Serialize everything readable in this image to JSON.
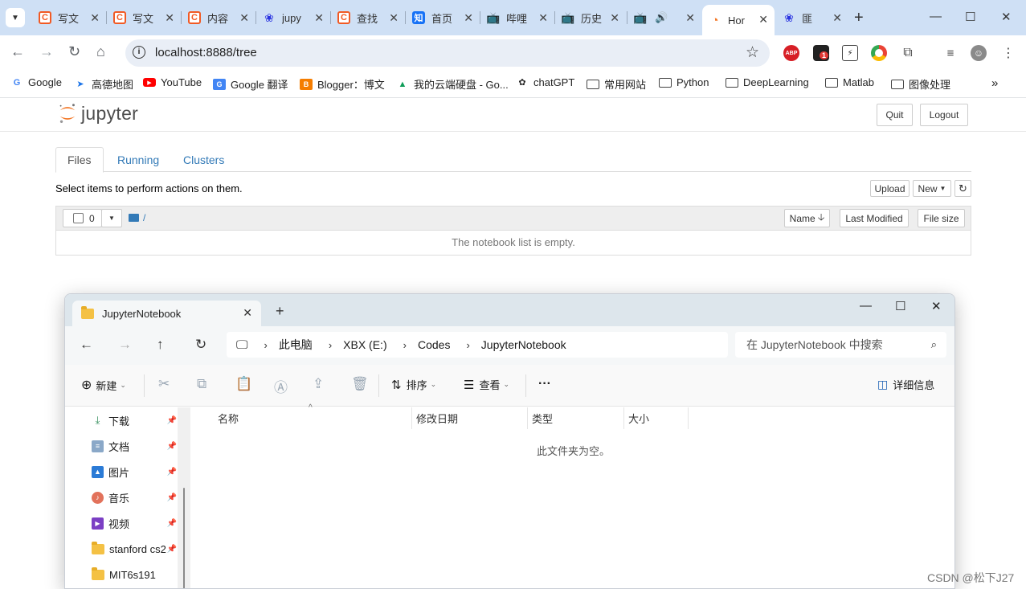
{
  "browser": {
    "tabs": [
      {
        "title": "写文",
        "favicon": "csdn-icon"
      },
      {
        "title": "写文",
        "favicon": "csdn-icon"
      },
      {
        "title": "内容",
        "favicon": "csdn-icon"
      },
      {
        "title": "jupy",
        "favicon": "baidu-icon"
      },
      {
        "title": "查找",
        "favicon": "csdn-icon"
      },
      {
        "title": "首页",
        "favicon": "zhihu-icon"
      },
      {
        "title": "哔哩",
        "favicon": "bilibili-icon"
      },
      {
        "title": "历史",
        "favicon": "bilibili-icon"
      },
      {
        "title": "",
        "favicon": "bilibili-icon"
      },
      {
        "title": "Hor",
        "favicon": "jupyter-icon"
      },
      {
        "title": "匪",
        "favicon": "baidu-icon"
      }
    ],
    "url": "localhost:8888/tree",
    "extension_badge": "1",
    "bookmarks": [
      {
        "label": "Google"
      },
      {
        "label": "高德地图"
      },
      {
        "label": "YouTube"
      },
      {
        "label": "Google 翻译"
      },
      {
        "label": "Blogger：博文"
      },
      {
        "label": "我的云端硬盘 - Go..."
      },
      {
        "label": "chatGPT"
      },
      {
        "label": "常用网站"
      },
      {
        "label": "Python"
      },
      {
        "label": "DeepLearning"
      },
      {
        "label": "Matlab"
      },
      {
        "label": "图像处理"
      }
    ]
  },
  "jupyter": {
    "logo_text": "jupyter",
    "quit_label": "Quit",
    "logout_label": "Logout",
    "tabs": [
      {
        "label": "Files"
      },
      {
        "label": "Running"
      },
      {
        "label": "Clusters"
      }
    ],
    "hint": "Select items to perform actions on them.",
    "upload_label": "Upload",
    "new_label": "New",
    "selected_count": "0",
    "path": "/",
    "col_name": "Name",
    "col_modified": "Last Modified",
    "col_size": "File size",
    "empty_message": "The notebook list is empty."
  },
  "explorer": {
    "tab_title": "JupyterNotebook",
    "breadcrumbs": [
      "此电脑",
      "XBX (E:)",
      "Codes",
      "JupyterNotebook"
    ],
    "search_placeholder": "在 JupyterNotebook 中搜索",
    "cmd_new": "新建",
    "cmd_sort": "排序",
    "cmd_view": "查看",
    "cmd_more": "···",
    "cmd_details": "详细信息",
    "nav_items": [
      {
        "label": "下载",
        "icon": "download-icon",
        "pinned": true
      },
      {
        "label": "文档",
        "icon": "document-icon",
        "pinned": true
      },
      {
        "label": "图片",
        "icon": "picture-icon",
        "pinned": true
      },
      {
        "label": "音乐",
        "icon": "music-icon",
        "pinned": true
      },
      {
        "label": "视频",
        "icon": "video-icon",
        "pinned": true
      },
      {
        "label": "stanford cs2",
        "icon": "folder-icon",
        "pinned": true
      },
      {
        "label": "MIT6s191",
        "icon": "folder-icon",
        "pinned": false
      }
    ],
    "columns": [
      "名称",
      "修改日期",
      "类型",
      "大小"
    ],
    "empty_message": "此文件夹为空。"
  },
  "watermark": "CSDN @松下J27",
  "colors": {
    "chrome_frame": "#cfe0f5",
    "omnibox": "#e9eef6",
    "jupyter_orange": "#f37726",
    "link_blue": "#337ab7",
    "explorer_title": "#dde6ec"
  }
}
